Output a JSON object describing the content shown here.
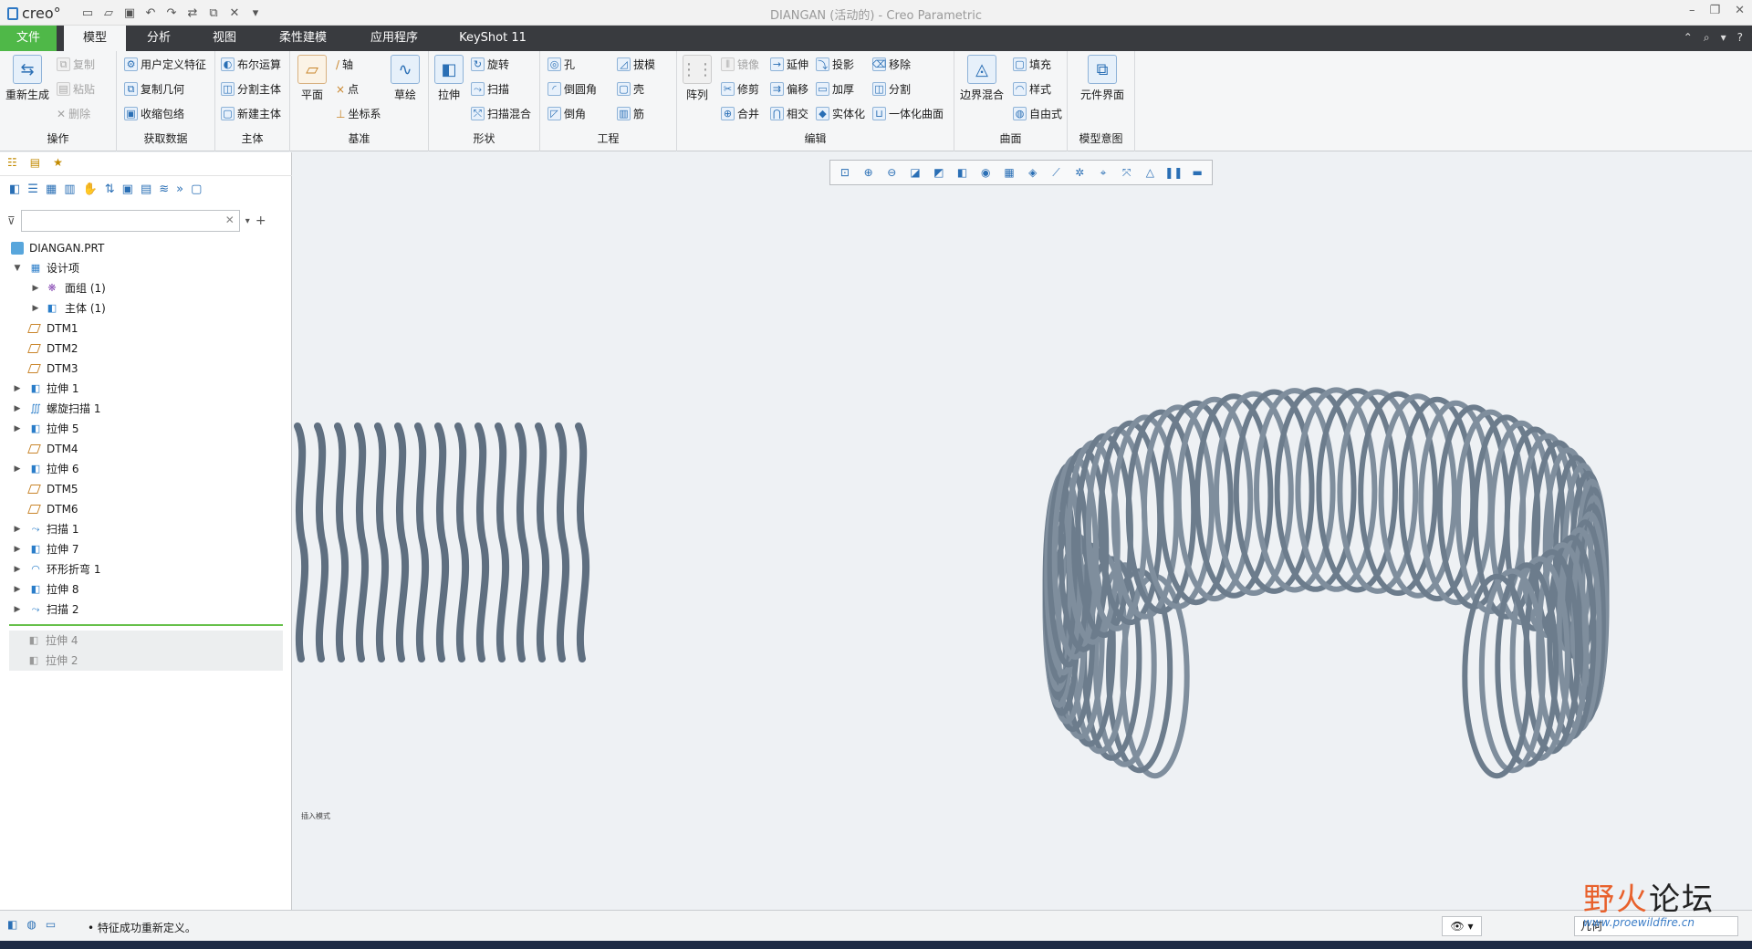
{
  "app": {
    "logo": "creo°",
    "window_title": "DIANGAN (活动的) - Creo Parametric"
  },
  "menu": {
    "tabs": [
      "文件",
      "模型",
      "分析",
      "视图",
      "柔性建模",
      "应用程序",
      "KeyShot 11"
    ],
    "active": "模型"
  },
  "ribbon": {
    "operations": {
      "regenerate": "重新生成",
      "copy": "复制",
      "paste": "粘贴",
      "delete": "删除",
      "label": "操作"
    },
    "get_data": {
      "udf": "用户定义特征",
      "copy_geom": "复制几何",
      "shrinkwrap": "收缩包络",
      "label": "获取数据"
    },
    "body": {
      "boolean": "布尔运算",
      "split_body": "分割主体",
      "new_body": "新建主体",
      "label": "主体"
    },
    "datum": {
      "plane": "平面",
      "axis": "轴",
      "point": "点",
      "csys": "坐标系",
      "sketch": "草绘",
      "label": "基准"
    },
    "shapes": {
      "extrude": "拉伸",
      "revolve": "旋转",
      "sweep": "扫描",
      "swept_blend": "扫描混合",
      "label": "形状"
    },
    "engineering": {
      "hole": "孔",
      "round": "倒圆角",
      "chamfer": "倒角",
      "draft": "拔模",
      "shell": "壳",
      "rib": "筋",
      "label": "工程"
    },
    "editing": {
      "pattern": "阵列",
      "mirror": "镜像",
      "extend": "延伸",
      "project": "投影",
      "trim": "修剪",
      "offset": "偏移",
      "thicken": "加厚",
      "merge": "合并",
      "intersect": "相交",
      "solidify": "实体化",
      "remove": "移除",
      "split": "分割",
      "unify": "一体化曲面",
      "label": "编辑"
    },
    "surfaces": {
      "boundary_blend": "边界混合",
      "fill": "填充",
      "style": "样式",
      "freestyle": "自由式",
      "label": "曲面"
    },
    "model_intent": {
      "component_interface": "元件界面",
      "label": "模型意图"
    }
  },
  "tree": {
    "root": "DIANGAN.PRT",
    "items": [
      "设计项",
      "面组 (1)",
      "主体 (1)",
      "DTM1",
      "DTM2",
      "DTM3",
      "拉伸 1",
      "螺旋扫描 1",
      "拉伸 5",
      "DTM4",
      "拉伸 6",
      "DTM5",
      "DTM6",
      "扫描 1",
      "拉伸 7",
      "环形折弯 1",
      "拉伸 8",
      "扫描 2"
    ],
    "suppressed": [
      "拉伸 4",
      "拉伸 2"
    ]
  },
  "viewport": {
    "mode_text": "插入模式"
  },
  "status": {
    "message": "• 特征成功重新定义。",
    "filter_label": "几何"
  },
  "watermark": {
    "title_a": "野火",
    "title_b": "论坛",
    "url": "www.proewildfire.cn"
  },
  "colors": {
    "file_tab": "#4fb848",
    "menubar": "#393b3f",
    "spring": "#6e7f90"
  }
}
